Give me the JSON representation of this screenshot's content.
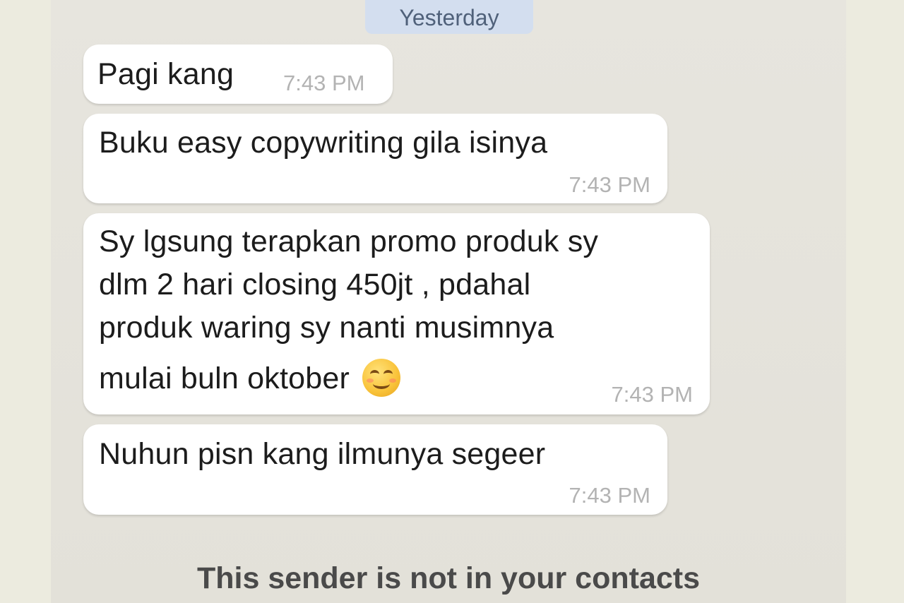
{
  "date_separator": "Yesterday",
  "messages": [
    {
      "lines": [
        "Pagi kang"
      ],
      "time": "7:43 PM"
    },
    {
      "lines": [
        "Buku easy copywriting gila isinya"
      ],
      "time": "7:43 PM"
    },
    {
      "lines": [
        "Sy lgsung terapkan promo produk sy",
        "dlm 2 hari closing 450jt , pdahal",
        "produk waring sy nanti musimnya",
        "mulai buln oktober"
      ],
      "emoji": "smiling-face-emoji",
      "time": "7:43 PM"
    },
    {
      "lines": [
        "Nuhun pisn kang ilmunya segeer"
      ],
      "time": "7:43 PM"
    }
  ],
  "notice": "This sender is not in your contacts",
  "colors": {
    "background": "#ecebdf",
    "chat_background": "#e5e3dc",
    "bubble": "#ffffff",
    "date_pill": "#d3deef",
    "timestamp": "#b3b3b3"
  }
}
